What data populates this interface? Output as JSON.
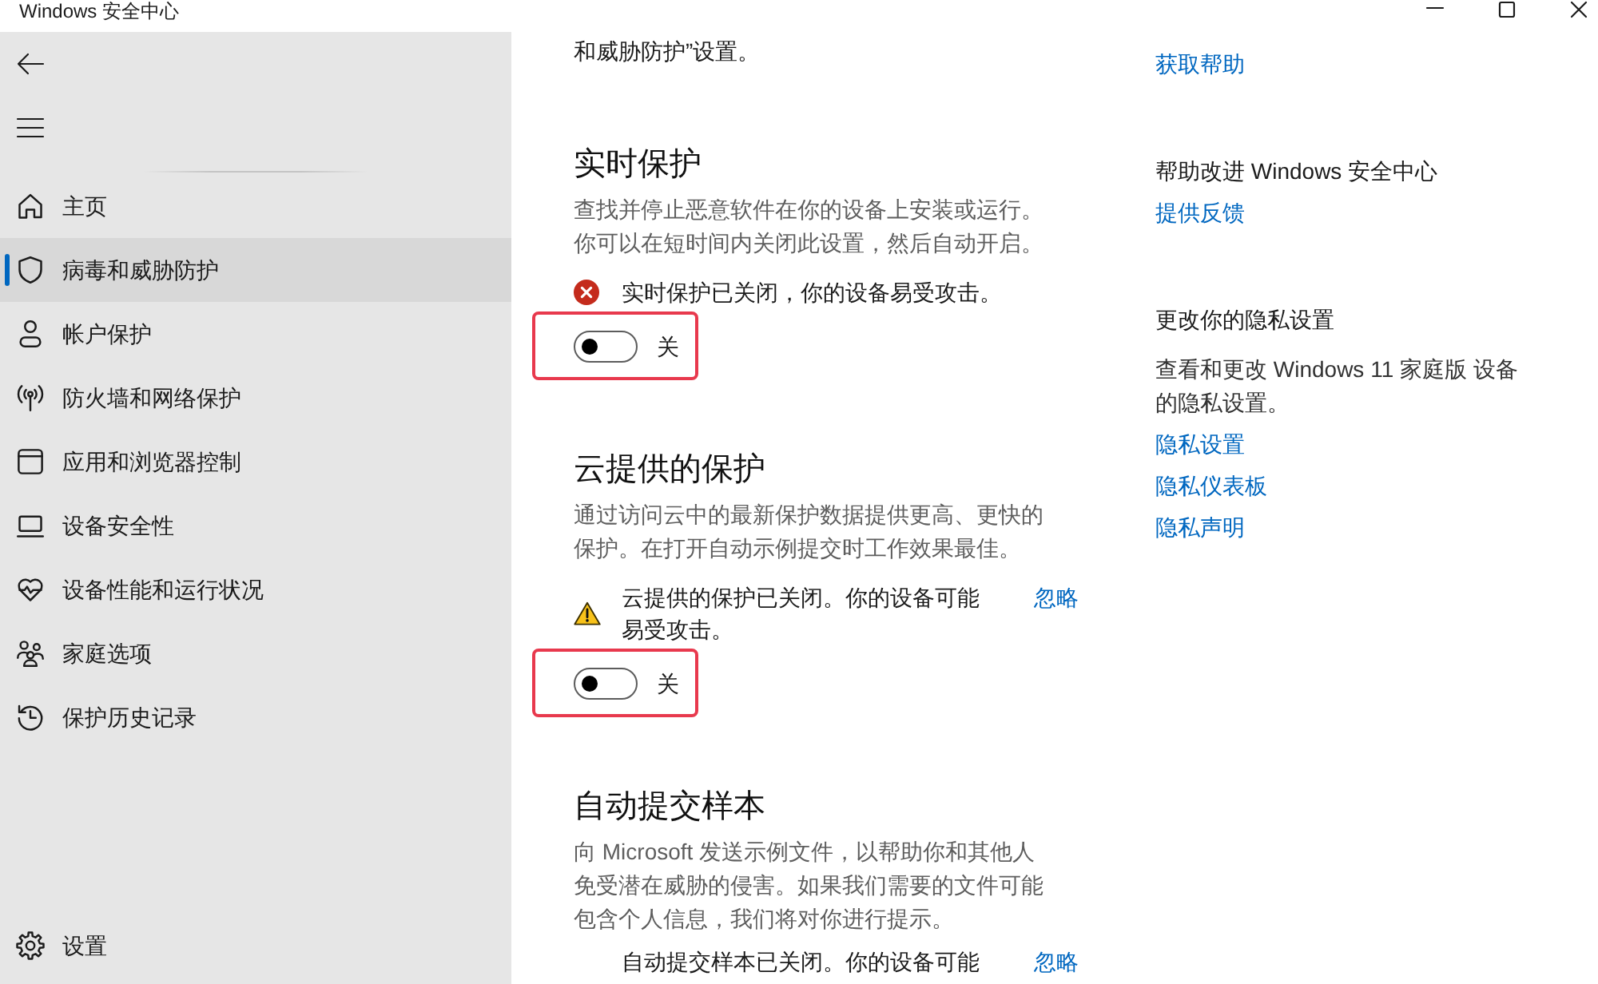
{
  "window": {
    "title": "Windows 安全中心"
  },
  "nav": {
    "items": [
      {
        "label": "主页",
        "selected": false
      },
      {
        "label": "病毒和威胁防护",
        "selected": true
      },
      {
        "label": "帐户保护",
        "selected": false
      },
      {
        "label": "防火墙和网络保护",
        "selected": false
      },
      {
        "label": "应用和浏览器控制",
        "selected": false
      },
      {
        "label": "设备安全性",
        "selected": false
      },
      {
        "label": "设备性能和运行状况",
        "selected": false
      },
      {
        "label": "家庭选项",
        "selected": false
      },
      {
        "label": "保护历史记录",
        "selected": false
      }
    ],
    "footer": {
      "label": "设置",
      "selected": false
    }
  },
  "content": {
    "intro": "和威胁防护”设置。",
    "sections": [
      {
        "title": "实时保护",
        "description": "查找并停止恶意软件在你的设备上安装或运行。你可以在短时间内关闭此设置，然后自动开启。",
        "alert": {
          "kind": "error",
          "text": "实时保护已关闭，你的设备易受攻击。"
        },
        "toggle": {
          "on": false,
          "label": "关",
          "highlighted": true
        }
      },
      {
        "title": "云提供的保护",
        "description": "通过访问云中的最新保护数据提供更高、更快的保护。在打开自动示例提交时工作效果最佳。",
        "alert": {
          "kind": "warning",
          "text": "云提供的保护已关闭。你的设备可能易受攻击。",
          "action": "忽略"
        },
        "toggle": {
          "on": false,
          "label": "关",
          "highlighted": true
        }
      },
      {
        "title": "自动提交样本",
        "description": "向 Microsoft 发送示例文件，以帮助你和其他人免受潜在威胁的侵害。如果我们需要的文件可能包含个人信息，我们将对你进行提示。",
        "alert": {
          "text": "自动提交样本已关闭。你的设备可能",
          "action": "忽略"
        }
      }
    ]
  },
  "help_panel": {
    "sections": [
      {
        "links": [
          "获取帮助"
        ]
      },
      {
        "title": "帮助改进 Windows 安全中心",
        "links": [
          "提供反馈"
        ]
      },
      {
        "title": "更改你的隐私设置",
        "text": "查看和更改 Windows 11 家庭版 设备的隐私设置。",
        "links": [
          "隐私设置",
          "隐私仪表板",
          "隐私声明"
        ]
      }
    ]
  }
}
